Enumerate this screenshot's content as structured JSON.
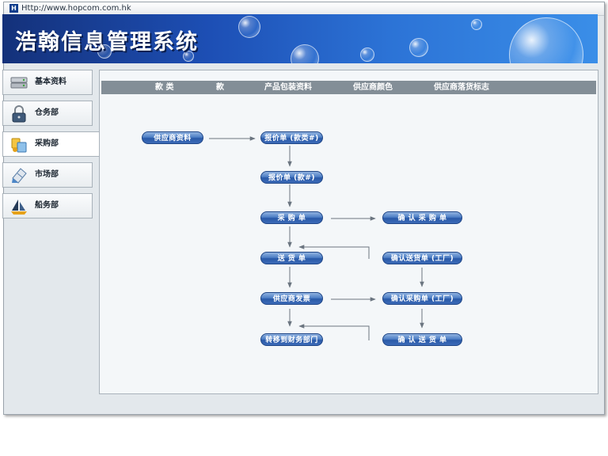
{
  "window": {
    "url": "Http://www.hopcom.com.hk"
  },
  "header": {
    "title": "浩翰信息管理系统"
  },
  "sidebar": {
    "items": [
      {
        "label": "基本资料",
        "icon": "server-icon"
      },
      {
        "label": "仓务部",
        "icon": "lock-icon"
      },
      {
        "label": "采购部",
        "icon": "shopping-icon"
      },
      {
        "label": "市场部",
        "icon": "document-icon"
      },
      {
        "label": "船务部",
        "icon": "sailboat-icon"
      }
    ],
    "active_index": 2
  },
  "tabs": [
    "款 类",
    "款",
    "产品包装资料",
    "供应商颜色",
    "供应商落货标志"
  ],
  "flow": {
    "supplier_info": "供应商资料",
    "quote_category": "报价单 (款类#)",
    "quote_style": "报价单 (款#)",
    "purchase_order": "采 购 单",
    "confirm_purchase": "确 认 采 购 单",
    "delivery_note": "送 货 单",
    "confirm_delivery_factory": "确认送货单 (工厂)",
    "supplier_invoice": "供应商发票",
    "confirm_purchase_factory": "确认采购单 (工厂)",
    "transfer_finance": "转移到财务部门",
    "confirm_delivery": "确 认 送 货 单"
  },
  "colors": {
    "node": "#3d6bb8",
    "tabbar": "#838e97",
    "arrow": "#6b7580"
  }
}
